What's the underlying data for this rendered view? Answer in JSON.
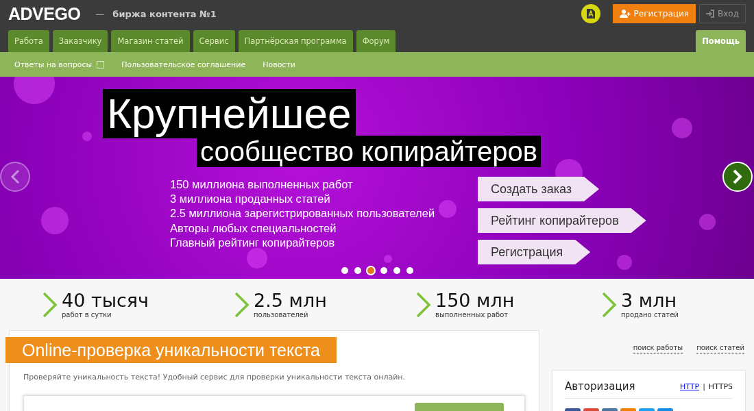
{
  "header": {
    "logo": "ADVEGO",
    "dash": "—",
    "tagline": "биржа контента №1",
    "register_button": "Регистрация",
    "login_button": "Вход"
  },
  "tabs": [
    {
      "label": "Работа",
      "selected": false
    },
    {
      "label": "Заказчику",
      "selected": false
    },
    {
      "label": "Магазин статей",
      "selected": false
    },
    {
      "label": "Сервис",
      "selected": false
    },
    {
      "label": "Партнёрская программа",
      "selected": false
    },
    {
      "label": "Форум",
      "selected": false
    },
    {
      "label": "Помощь",
      "selected": true
    }
  ],
  "subnav": [
    {
      "label": "Ответы на вопросы",
      "dropdown": true
    },
    {
      "label": "Пользовательское соглашение",
      "dropdown": false
    },
    {
      "label": "Новости",
      "dropdown": false
    }
  ],
  "banner": {
    "title": "Крупнейшее",
    "subtitle": "сообщество копирайтеров",
    "facts": [
      "150 миллиона выполненных работ",
      "3 миллиона проданных статей",
      "2.5 миллиона зарегистрированных пользователей",
      "Авторы любых специальностей",
      "Главный рейтинг копирайтеров"
    ],
    "buttons": [
      "Создать заказ",
      "Рейтинг копирайтеров",
      "Регистрация"
    ],
    "dots": [
      {
        "selected": false
      },
      {
        "selected": false
      },
      {
        "selected": true
      },
      {
        "selected": false
      },
      {
        "selected": false
      },
      {
        "selected": false
      }
    ]
  },
  "stats": [
    {
      "value": "40 тысяч",
      "caption": "работ в сутки"
    },
    {
      "value": "2.5 млн",
      "caption": "пользователей"
    },
    {
      "value": "150 млн",
      "caption": "выполненных работ"
    },
    {
      "value": "3 млн",
      "caption": "продано статей"
    }
  ],
  "checker": {
    "title": "Online-проверка уникальности текста",
    "description": "Проверяйте уникальность текста! Удобный сервис для проверки уникальности текста онлайн."
  },
  "side_links": [
    "поиск работы",
    "поиск статей"
  ],
  "auth": {
    "title": "Авторизация",
    "http": "HTTP",
    "separator": "|",
    "https": "HTTPS"
  }
}
